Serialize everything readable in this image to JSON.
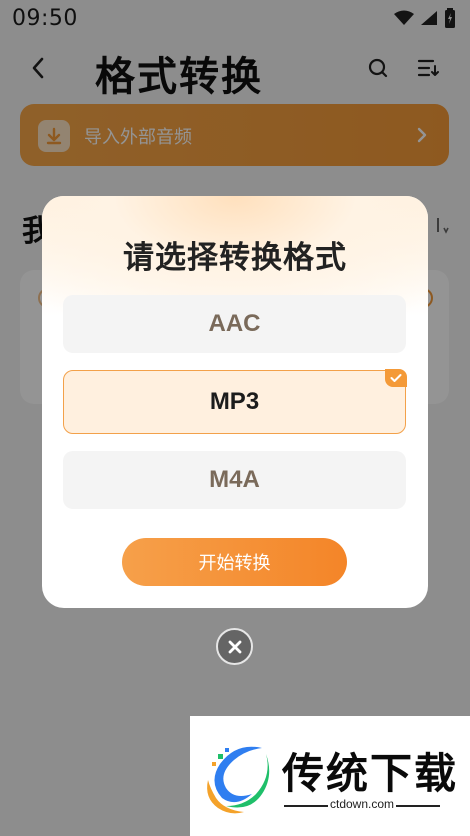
{
  "status_bar": {
    "time": "09:50",
    "icons": [
      "wifi-icon",
      "signal-icon",
      "battery-icon"
    ]
  },
  "nav": {
    "title": "格式转换",
    "back_icon": "chevron-left-icon",
    "search_icon": "search-icon",
    "menu_icon": "list-menu-icon"
  },
  "import_banner": {
    "label": "导入外部音频",
    "icon": "download-icon",
    "arrow_icon": "chevron-right-icon"
  },
  "section": {
    "title_partial": "我"
  },
  "dialog": {
    "title": "请选择转换格式",
    "options": [
      {
        "label": "AAC",
        "selected": false
      },
      {
        "label": "MP3",
        "selected": true
      },
      {
        "label": "M4A",
        "selected": false
      }
    ],
    "start_button": "开始转换",
    "close_icon": "close-icon"
  },
  "watermark": {
    "brand": "传统下载",
    "url": "ctdown.com"
  },
  "colors": {
    "accent": "#f49a38",
    "accent_light": "#fff0df",
    "title_text": "#222222",
    "overlay": "rgba(0,0,0,0.42)"
  }
}
